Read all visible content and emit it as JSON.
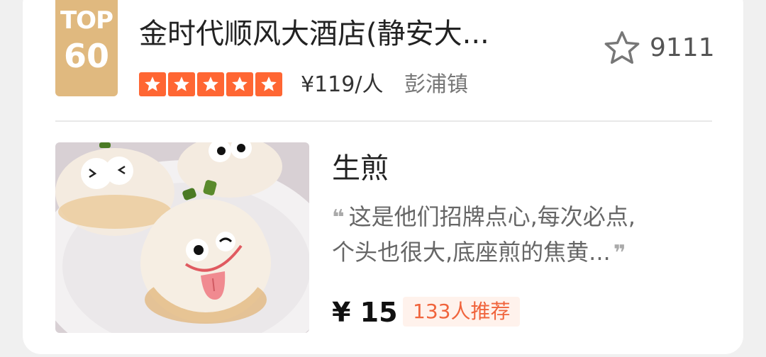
{
  "restaurant": {
    "rank_badge": {
      "top_label": "TOP",
      "rank": "60"
    },
    "name": "金时代顺风大酒店(静安大...",
    "rating_stars": 5,
    "price_per_person": "¥119/人",
    "district": "彭浦镇",
    "favorite_icon": "star-outline-icon",
    "favorite_count": "9111"
  },
  "dish": {
    "name": "生煎",
    "review_lines": [
      "这是他们招牌点心,每次必点,",
      "个头也很大,底座煎的焦黄..."
    ],
    "open_quote": "❝",
    "close_quote": "❞",
    "price": "¥ 15",
    "recommend_count": "133人推荐",
    "photo_icon": "dumpling-photo"
  },
  "colors": {
    "badge": "#e0b97f",
    "star_fill": "#ff6633",
    "recommend_text": "#f0643c",
    "recommend_bg": "#fff2ec"
  }
}
